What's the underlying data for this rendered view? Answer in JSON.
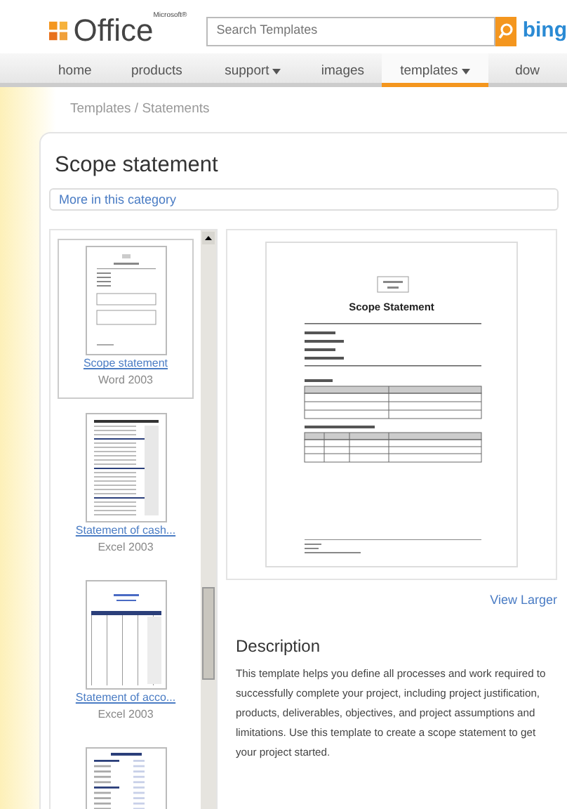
{
  "header": {
    "logo_text": "Office",
    "logo_superscript": "Microsoft®",
    "search": {
      "placeholder": "Search Templates"
    },
    "partner": "bing"
  },
  "nav": [
    {
      "label": "home",
      "caret": false,
      "selected": false
    },
    {
      "label": "products",
      "caret": false,
      "selected": false
    },
    {
      "label": "support",
      "caret": true,
      "selected": false
    },
    {
      "label": "images",
      "caret": false,
      "selected": false
    },
    {
      "label": "templates",
      "caret": true,
      "selected": true
    },
    {
      "label": "dow",
      "caret": false,
      "selected": false
    }
  ],
  "breadcrumb": "Templates / Statements",
  "panel": {
    "title": "Scope statement",
    "category_link": "More in this category",
    "templates": [
      {
        "kind": "word",
        "title": "Scope statement",
        "app": "Word 2003",
        "selected": true
      },
      {
        "kind": "excel-cash",
        "title": "Statement of cash...",
        "app": "Excel 2003",
        "selected": false
      },
      {
        "kind": "excel-account",
        "title": "Statement of acco...",
        "app": "Excel 2003",
        "selected": false
      },
      {
        "kind": "excel-income",
        "selected": false
      }
    ],
    "preview": {
      "doc_title": "Scope Statement"
    },
    "view_larger": "View Larger",
    "description_heading": "Description",
    "description": "This template helps you define all processes and work required to successfully complete your project, including project justification, products, deliverables, objectives, and project assumptions and limitations. Use this template to create a scope statement to get your project started."
  }
}
